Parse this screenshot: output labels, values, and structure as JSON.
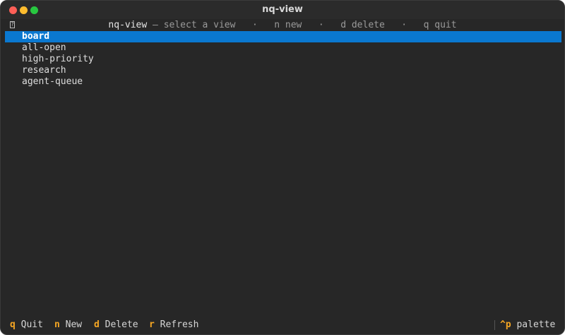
{
  "window": {
    "title": "nq-view"
  },
  "header": {
    "icon": "?",
    "app": "nq-view",
    "subtitle": " — select a view",
    "dot1": "·",
    "hint_new": "n new",
    "dot2": "·",
    "hint_delete": "d delete",
    "dot3": "·",
    "hint_quit": "q quit"
  },
  "views": [
    {
      "label": "board",
      "selected": true
    },
    {
      "label": "all-open",
      "selected": false
    },
    {
      "label": "high-priority",
      "selected": false
    },
    {
      "label": "research",
      "selected": false
    },
    {
      "label": "agent-queue",
      "selected": false
    }
  ],
  "footer": {
    "quit": {
      "key": "q",
      "label": "Quit"
    },
    "new": {
      "key": "n",
      "label": "New"
    },
    "delete": {
      "key": "d",
      "label": "Delete"
    },
    "refresh": {
      "key": "r",
      "label": "Refresh"
    },
    "palette": {
      "key": "^p",
      "label": "palette"
    }
  },
  "colors": {
    "selection": "#0a78d0",
    "key_accent": "#f5a623",
    "background": "#272727"
  }
}
